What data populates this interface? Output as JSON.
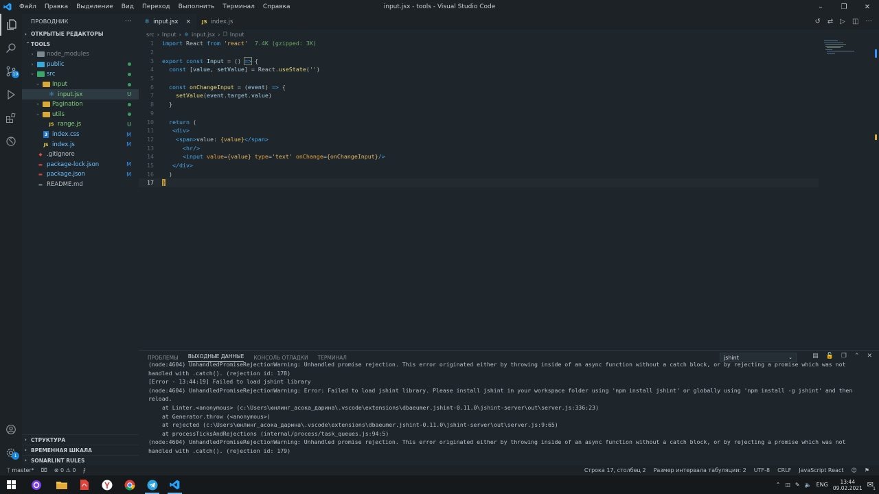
{
  "window": {
    "title": "input.jsx - tools - Visual Studio Code",
    "menu": [
      "Файл",
      "Правка",
      "Выделение",
      "Вид",
      "Переход",
      "Выполнить",
      "Терминал",
      "Справка"
    ]
  },
  "activity_badges": {
    "scm": "10",
    "settings": "1"
  },
  "sidebar": {
    "title": "ПРОВОДНИК",
    "more": "···",
    "open_editors": "ОТКРЫТЫЕ РЕДАКТОРЫ",
    "root": "TOOLS",
    "tree": [
      {
        "label": "node_modules",
        "kind": "folder",
        "depth": 1,
        "expanded": false,
        "color": "#7a8a8e",
        "status": "",
        "status_type": "none",
        "label_color": "#7f8990"
      },
      {
        "label": "public",
        "kind": "folder",
        "depth": 1,
        "expanded": false,
        "color": "#3aa8d8",
        "status": "",
        "status_type": "dot",
        "status_color": "#3f9a62",
        "label_color": "#6ec1ff"
      },
      {
        "label": "src",
        "kind": "folder",
        "depth": 1,
        "expanded": true,
        "color": "#3aa86b",
        "status": "",
        "status_type": "dot",
        "status_color": "#3f9a62",
        "label_color": "#6ec1ff"
      },
      {
        "label": "Input",
        "kind": "folder",
        "depth": 2,
        "expanded": true,
        "color": "#d8a83a",
        "status": "",
        "status_type": "dot",
        "status_color": "#3f9a62",
        "label_color": "#7fd07a"
      },
      {
        "label": "input.jsx",
        "kind": "react",
        "depth": 3,
        "selected": true,
        "status": "U",
        "status_type": "text",
        "status_color": "#73c991",
        "label_color": "#7fd07a"
      },
      {
        "label": "Pagination",
        "kind": "folder",
        "depth": 2,
        "expanded": false,
        "color": "#d8a83a",
        "status": "",
        "status_type": "dot",
        "status_color": "#3f9a62",
        "label_color": "#7fd07a"
      },
      {
        "label": "utils",
        "kind": "folder",
        "depth": 2,
        "expanded": true,
        "color": "#d8a83a",
        "status": "",
        "status_type": "dot",
        "status_color": "#3f9a62",
        "label_color": "#7fd07a"
      },
      {
        "label": "range.js",
        "kind": "js",
        "depth": 3,
        "status": "U",
        "status_type": "text",
        "status_color": "#73c991",
        "label_color": "#7fd07a"
      },
      {
        "label": "index.css",
        "kind": "css",
        "depth": 2,
        "status": "M",
        "status_type": "text",
        "status_color": "#3794ff",
        "label_color": "#6ec1ff"
      },
      {
        "label": "index.js",
        "kind": "js",
        "depth": 2,
        "status": "M",
        "status_type": "text",
        "status_color": "#3794ff",
        "label_color": "#6ec1ff"
      },
      {
        "label": ".gitignore",
        "kind": "git",
        "depth": 1,
        "status": "",
        "status_type": "none",
        "label_color": "#b6c0c7"
      },
      {
        "label": "package-lock.json",
        "kind": "json",
        "depth": 1,
        "status": "M",
        "status_type": "text",
        "status_color": "#3794ff",
        "label_color": "#6ec1ff"
      },
      {
        "label": "package.json",
        "kind": "json",
        "depth": 1,
        "status": "M",
        "status_type": "text",
        "status_color": "#3794ff",
        "label_color": "#6ec1ff"
      },
      {
        "label": "README.md",
        "kind": "md",
        "depth": 1,
        "status": "",
        "status_type": "none",
        "label_color": "#b6c0c7"
      }
    ],
    "bottom_sections": [
      "СТРУКТУРА",
      "ВРЕМЕННАЯ ШКАЛА",
      "SONARLINT RULES"
    ]
  },
  "tabs": [
    {
      "label": "input.jsx",
      "active": true,
      "close": "×"
    },
    {
      "label": "index.js",
      "active": false
    }
  ],
  "breadcrumb": [
    "src",
    "Input",
    "input.jsx",
    "Input"
  ],
  "code_lines": [
    [
      [
        "kw",
        "import"
      ],
      [
        "lt",
        " React "
      ],
      [
        "kw",
        "from"
      ],
      [
        "lt",
        " "
      ],
      [
        "str",
        "'react'"
      ],
      [
        "lt",
        "  "
      ],
      [
        "size",
        "7.4K (gzipped: 3K)"
      ]
    ],
    [],
    [
      [
        "kw",
        "export"
      ],
      [
        "lt",
        " "
      ],
      [
        "kw",
        "const"
      ],
      [
        "lt",
        " "
      ],
      [
        "var",
        "Input"
      ],
      [
        "lt",
        " = "
      ],
      [
        "lt",
        "() "
      ],
      [
        "kw",
        "=>"
      ],
      [
        "lt",
        " {"
      ]
    ],
    [
      [
        "lt",
        "  "
      ],
      [
        "kw",
        "const"
      ],
      [
        "lt",
        " ["
      ],
      [
        "var",
        "value"
      ],
      [
        "lt",
        ", "
      ],
      [
        "var",
        "setValue"
      ],
      [
        "lt",
        "] = React."
      ],
      [
        "fn",
        "useState"
      ],
      [
        "lt",
        "("
      ],
      [
        "str",
        "''"
      ],
      [
        "lt",
        ")"
      ]
    ],
    [],
    [
      [
        "lt",
        "  "
      ],
      [
        "kw",
        "const"
      ],
      [
        "lt",
        " "
      ],
      [
        "fn",
        "onChangeInput"
      ],
      [
        "lt",
        " = ("
      ],
      [
        "var",
        "event"
      ],
      [
        "lt",
        ") "
      ],
      [
        "kw",
        "=>"
      ],
      [
        "lt",
        " {"
      ]
    ],
    [
      [
        "lt",
        "    "
      ],
      [
        "fn",
        "setValue"
      ],
      [
        "lt",
        "("
      ],
      [
        "var",
        "event"
      ],
      [
        "lt",
        "."
      ],
      [
        "var",
        "target"
      ],
      [
        "lt",
        "."
      ],
      [
        "var",
        "value"
      ],
      [
        "lt",
        ")"
      ]
    ],
    [
      [
        "lt",
        "  }"
      ]
    ],
    [],
    [
      [
        "lt",
        "  "
      ],
      [
        "kw",
        "return"
      ],
      [
        "lt",
        " ("
      ]
    ],
    [
      [
        "lt",
        "   "
      ],
      [
        "tag",
        "<div>"
      ]
    ],
    [
      [
        "lt",
        "    "
      ],
      [
        "tag",
        "<span>"
      ],
      [
        "lt",
        "value: "
      ],
      [
        "str",
        "{value}"
      ],
      [
        "tag",
        "</span>"
      ]
    ],
    [
      [
        "lt",
        "      "
      ],
      [
        "tag",
        "<hr/>"
      ]
    ],
    [
      [
        "lt",
        "      "
      ],
      [
        "tag",
        "<input"
      ],
      [
        "lt",
        " "
      ],
      [
        "attr",
        "value"
      ],
      [
        "lt",
        "="
      ],
      [
        "str",
        "{value}"
      ],
      [
        "lt",
        " "
      ],
      [
        "attr",
        "type"
      ],
      [
        "lt",
        "="
      ],
      [
        "str",
        "'text'"
      ],
      [
        "lt",
        " "
      ],
      [
        "attr",
        "onChange"
      ],
      [
        "lt",
        "="
      ],
      [
        "str",
        "{onChangeInput}"
      ],
      [
        "tag",
        "/>"
      ]
    ],
    [
      [
        "lt",
        "   "
      ],
      [
        "tag",
        "</div>"
      ]
    ],
    [
      [
        "lt",
        "  )"
      ]
    ],
    [
      [
        "cursor",
        "}"
      ]
    ]
  ],
  "current_line": 17,
  "panel": {
    "tabs": [
      "ПРОБЛЕМЫ",
      "ВЫХОДНЫЕ ДАННЫЕ",
      "КОНСОЛЬ ОТЛАДКИ",
      "ТЕРМИНАЛ"
    ],
    "active_tab": 1,
    "select_value": "jshint",
    "output": [
      {
        "text": "(node:4604) UnhandledPromiseRejectionWarning: Unhandled promise rejection. This error originated either by throwing inside of an async function without a catch block, or by rejecting a promise which was not handled with .catch(). (rejection id: 178)",
        "indent": false
      },
      {
        "text": "[Error - 13:44:19] Failed to load jshint library",
        "indent": false
      },
      {
        "text": "(node:4604) UnhandledPromiseRejectionWarning: Error: Failed to load jshint library. Please install jshint in your workspace folder using 'npm install jshint' or globally using 'npm install -g jshint' and then reload.",
        "indent": false
      },
      {
        "text": "at Linter.<anonymous> (c:\\Users\\юнлинг_асока_дарина\\.vscode\\extensions\\dbaeumer.jshint-0.11.0\\jshint-server\\out\\server.js:336:23)",
        "indent": true
      },
      {
        "text": "at Generator.throw (<anonymous>)",
        "indent": true
      },
      {
        "text": "at rejected (c:\\Users\\юнлинг_асока_дарина\\.vscode\\extensions\\dbaeumer.jshint-0.11.0\\jshint-server\\out\\server.js:9:65)",
        "indent": true
      },
      {
        "text": "at processTicksAndRejections (internal/process/task_queues.js:94:5)",
        "indent": true
      },
      {
        "text": "(node:4604) UnhandledPromiseRejectionWarning: Unhandled promise rejection. This error originated either by throwing inside of an async function without a catch block, or by rejecting a promise which was not handled with .catch(). (rejection id: 179)",
        "indent": false
      }
    ]
  },
  "statusbar": {
    "branch": "master*",
    "errors": "0",
    "warnings": "0",
    "position": "Строка 17, столбец 2",
    "indent": "Размер интервала табуляции: 2",
    "encoding": "UTF-8",
    "eol": "CRLF",
    "language": "JavaScript React"
  },
  "taskbar": {
    "lang": "ENG",
    "time": "13:44",
    "date": "09.02.2021",
    "notifications": "1"
  },
  "colors": {
    "accent": "#1b86d8",
    "modified": "#3794ff",
    "untracked": "#73c991"
  }
}
